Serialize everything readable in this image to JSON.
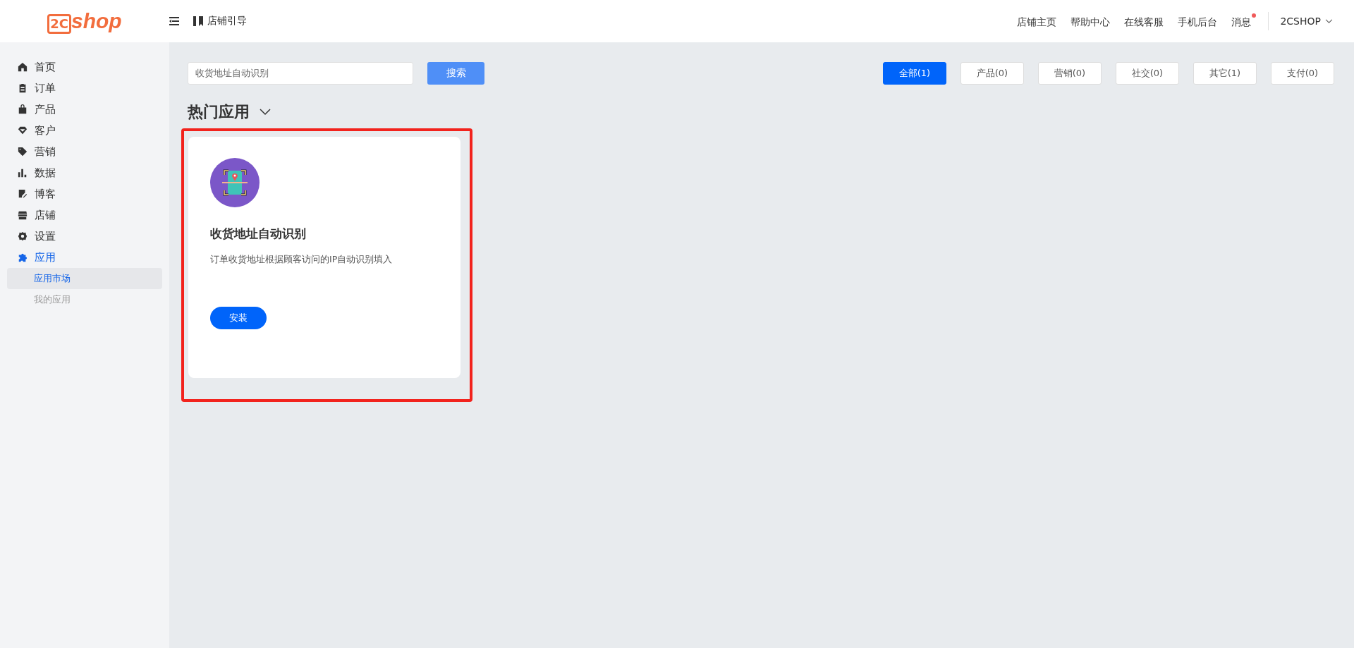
{
  "logo": {
    "mark": "2C",
    "text": "shop"
  },
  "header": {
    "guide": "店铺引导",
    "links": [
      {
        "label": "店铺主页",
        "badge": false
      },
      {
        "label": "帮助中心",
        "badge": false
      },
      {
        "label": "在线客服",
        "badge": false
      },
      {
        "label": "手机后台",
        "badge": false
      },
      {
        "label": "消息",
        "badge": true
      }
    ],
    "account": "2CSHOP"
  },
  "sidebar": {
    "items": [
      {
        "label": "首页",
        "selected": false
      },
      {
        "label": "订单",
        "selected": false
      },
      {
        "label": "产品",
        "selected": false
      },
      {
        "label": "客户",
        "selected": false
      },
      {
        "label": "营销",
        "selected": false
      },
      {
        "label": "数据",
        "selected": false
      },
      {
        "label": "博客",
        "selected": false
      },
      {
        "label": "店铺",
        "selected": false
      },
      {
        "label": "设置",
        "selected": false
      },
      {
        "label": "应用",
        "selected": true,
        "children": [
          {
            "label": "应用市场",
            "selected": true
          },
          {
            "label": "我的应用",
            "selected": false
          }
        ]
      }
    ]
  },
  "search": {
    "value": "收货地址自动识别",
    "button": "搜索"
  },
  "filters": [
    {
      "label": "全部(1)",
      "selected": true
    },
    {
      "label": "产品(0)",
      "selected": false
    },
    {
      "label": "营销(0)",
      "selected": false
    },
    {
      "label": "社交(0)",
      "selected": false
    },
    {
      "label": "其它(1)",
      "selected": false
    },
    {
      "label": "支付(0)",
      "selected": false
    }
  ],
  "section": {
    "title": "热门应用",
    "expanded": true
  },
  "apps": [
    {
      "name": "收货地址自动识别",
      "description": "订单收货地址根据顾客访问的IP自动识别填入",
      "button": "安装",
      "highlighted": true
    }
  ]
}
